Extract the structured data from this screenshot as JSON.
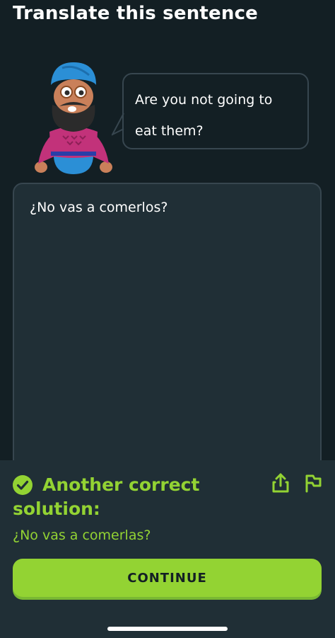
{
  "header": {
    "title": "Translate this sentence"
  },
  "prompt": {
    "sentence": "Are you not going to eat them?"
  },
  "answer": {
    "text": "¿No vas a comerlos?"
  },
  "feedback": {
    "title": "Another correct solution:",
    "solution": "¿No vas a comerlas?",
    "continue_label": "CONTINUE",
    "icons": {
      "check": "check-circle-icon",
      "share": "share-icon",
      "report": "flag-icon"
    }
  },
  "colors": {
    "background": "#131f24",
    "panel": "#202f36",
    "border": "#37464f",
    "accent_green": "#93d333"
  }
}
